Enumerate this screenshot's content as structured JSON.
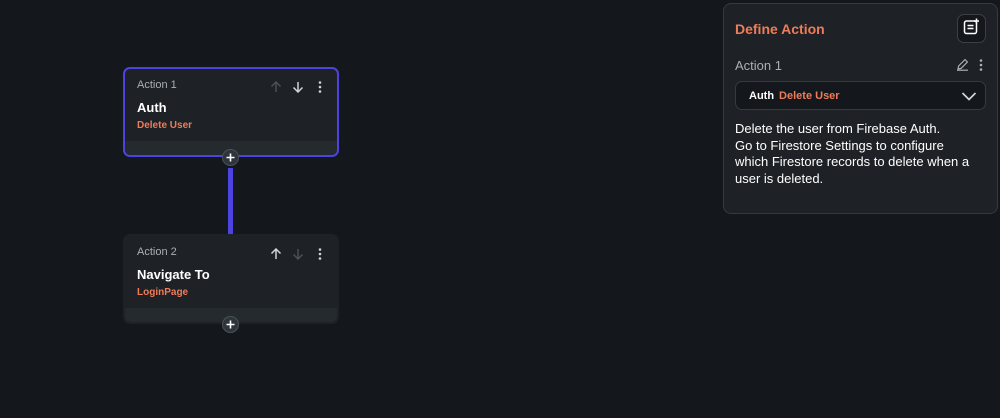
{
  "flow": {
    "actions": [
      {
        "label": "Action 1",
        "title": "Auth",
        "subtitle": "Delete User"
      },
      {
        "label": "Action 2",
        "title": "Navigate To",
        "subtitle": "LoginPage"
      }
    ]
  },
  "panel": {
    "title": "Define Action",
    "action_label": "Action 1",
    "selected_type": "Auth",
    "selected_action": "Delete User",
    "description_lines": [
      "Delete the user from Firebase Auth.",
      "Go to Firestore Settings to configure",
      "which Firestore records to delete when a",
      "user is deleted."
    ]
  },
  "colors": {
    "accent": "#ef7c58",
    "selected_border": "#4c43e0",
    "background": "#14171b",
    "card": "#1e2226"
  }
}
